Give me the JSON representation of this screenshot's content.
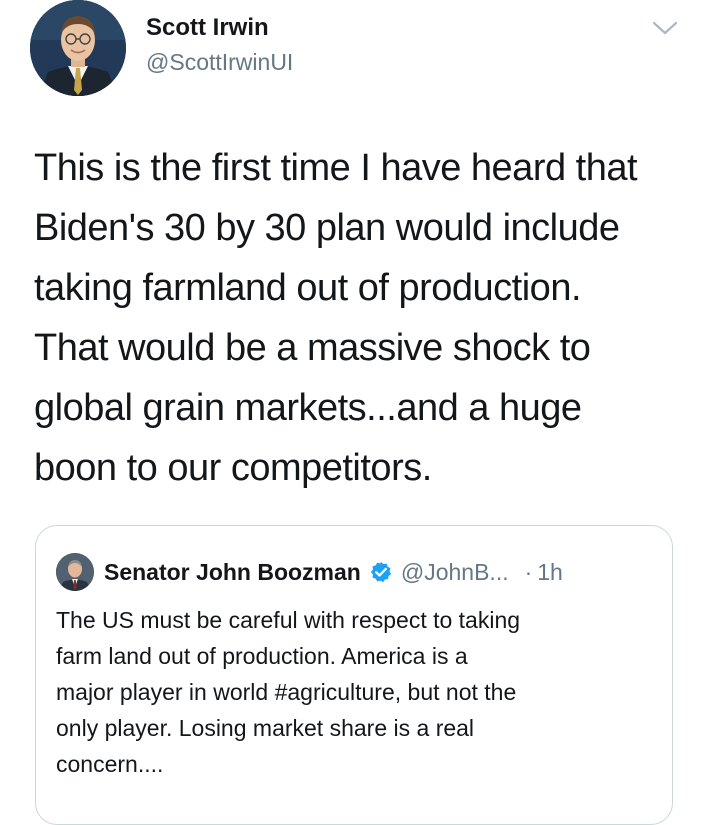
{
  "tweet": {
    "author_name": "Scott Irwin",
    "author_handle": "@ScottIrwinUI",
    "text_lines": [
      "This is the first time I have heard that",
      "Biden's 30 by 30 plan would include",
      "taking farmland out of production.",
      "That would be a massive shock to",
      "global grain markets...and a huge",
      "boon to our competitors."
    ]
  },
  "quoted_tweet": {
    "author_name": "Senator John Boozman",
    "author_handle": "@JohnB...",
    "separator": "·",
    "time": "1h",
    "text_lines": [
      "The US must be careful with respect to taking",
      "farm land out of production. America is a",
      "major player in world #agriculture, but not the",
      "only player. Losing market share is a real",
      "concern...."
    ]
  },
  "icons": {
    "menu": "chevron-down-icon",
    "verified": "verified-badge-icon"
  },
  "colors": {
    "text": "#14171a",
    "secondary": "#657786",
    "verified": "#1da1f2",
    "border": "#ccd6dd"
  }
}
